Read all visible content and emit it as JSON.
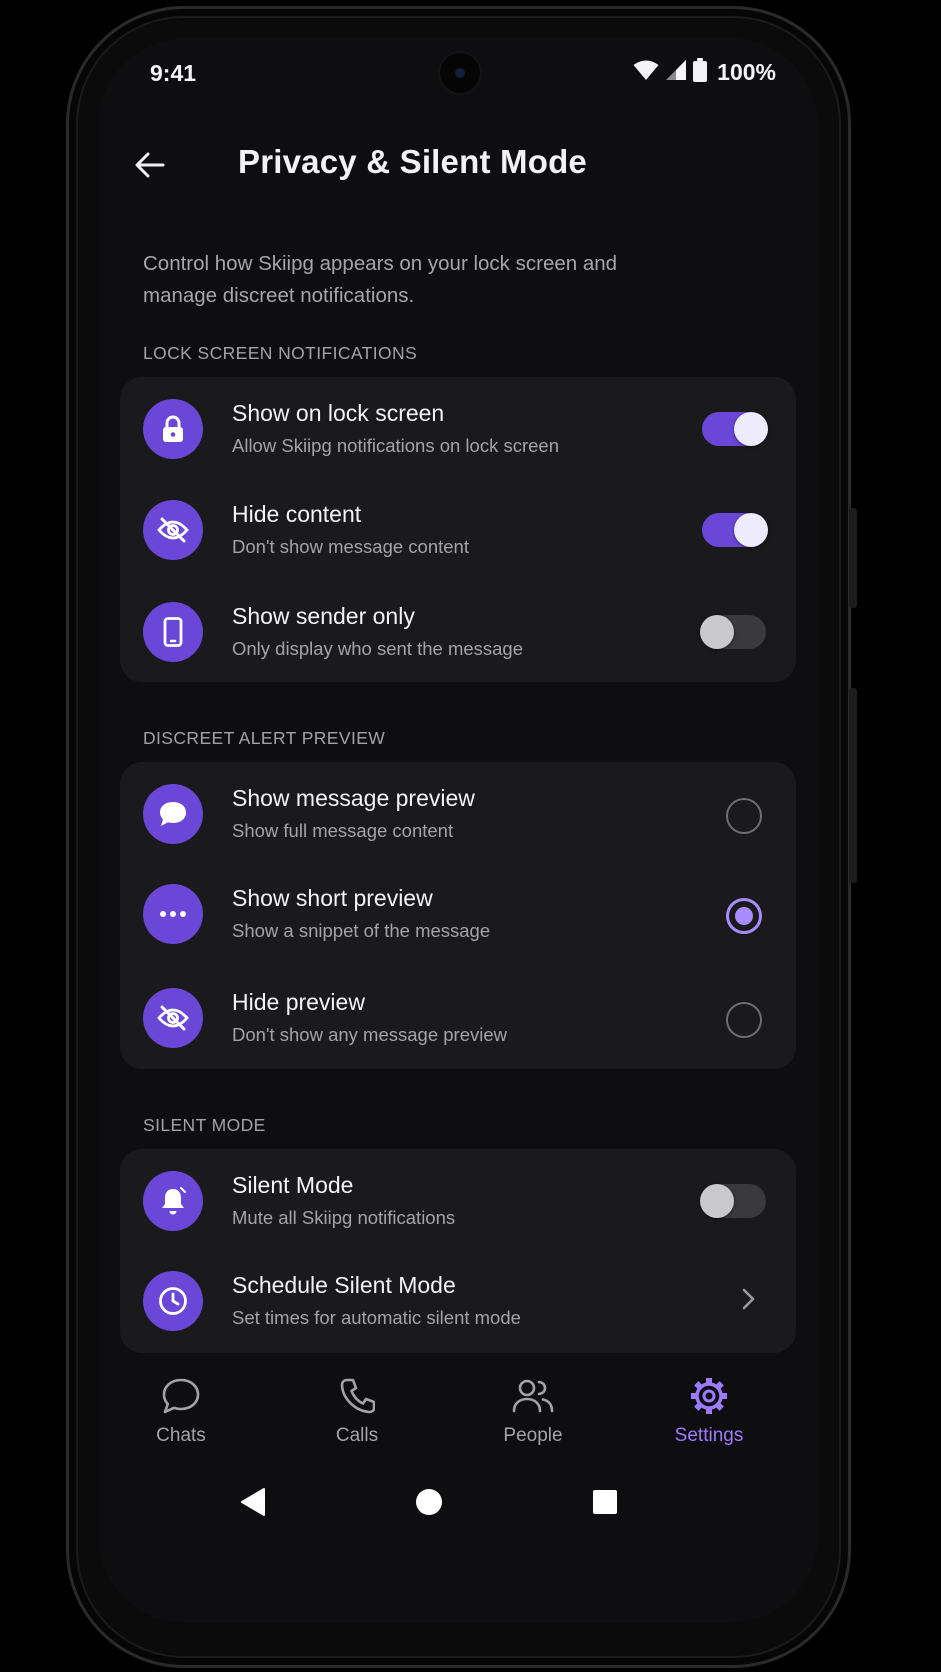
{
  "status_bar": {
    "time": "9:41",
    "battery": "100%"
  },
  "header": {
    "title": "Privacy & Silent Mode"
  },
  "intro": "Control how Skiipg appears on your lock screen and manage discreet notifications.",
  "sections": {
    "lock_screen": {
      "label": "LOCK SCREEN NOTIFICATIONS",
      "items": [
        {
          "title": "Show on lock screen",
          "subtitle": "Allow Skiipg notifications on lock screen",
          "icon": "lock-icon",
          "state": "on"
        },
        {
          "title": "Hide content",
          "subtitle": "Don't show message content",
          "icon": "eye-off-icon",
          "state": "on"
        },
        {
          "title": "Show sender only",
          "subtitle": "Only display who sent the message",
          "icon": "phone-icon",
          "state": "off"
        }
      ]
    },
    "alert_preview": {
      "label": "DISCREET ALERT PREVIEW",
      "items": [
        {
          "title": "Show message preview",
          "subtitle": "Show full message content",
          "icon": "message-bubble-icon",
          "selected": false
        },
        {
          "title": "Show short preview",
          "subtitle": "Show a snippet of the message",
          "icon": "more-dots-icon",
          "selected": true
        },
        {
          "title": "Hide preview",
          "subtitle": "Don't show any message preview",
          "icon": "eye-off-icon",
          "selected": false
        }
      ]
    },
    "silent_mode": {
      "label": "SILENT MODE",
      "items": [
        {
          "title": "Silent Mode",
          "subtitle": "Mute all Skiipg notifications",
          "icon": "bell-icon",
          "state": "off"
        },
        {
          "title": "Schedule Silent Mode",
          "subtitle": "Set times for automatic silent mode",
          "icon": "clock-icon"
        }
      ]
    }
  },
  "bottom_nav": [
    {
      "label": "Chats",
      "icon": "chat-icon",
      "active": false
    },
    {
      "label": "Calls",
      "icon": "phone-call-icon",
      "active": false
    },
    {
      "label": "People",
      "icon": "people-icon",
      "active": false
    },
    {
      "label": "Settings",
      "icon": "gear-icon",
      "active": true
    }
  ],
  "colors": {
    "accent": "#6a47d6",
    "accent_light": "#9d7bff",
    "background": "#0e0e10",
    "card": "#1a1a1d"
  }
}
